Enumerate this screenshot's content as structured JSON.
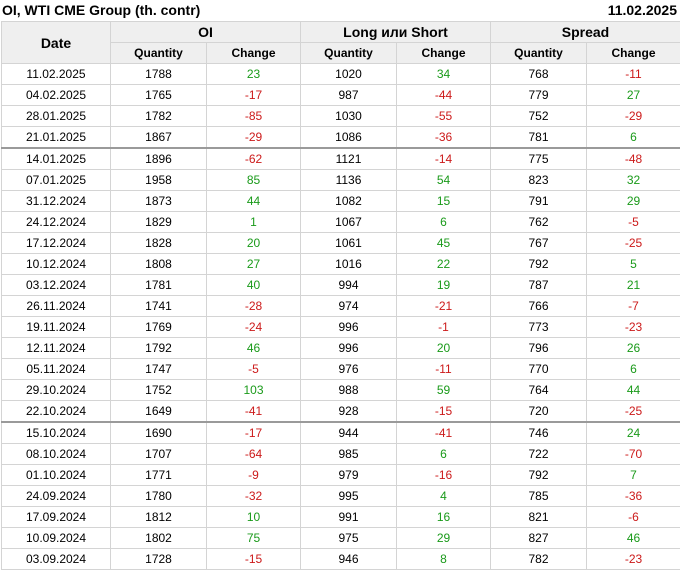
{
  "header": {
    "title": "OI, WTI CME Group (th. contr)",
    "date": "11.02.2025"
  },
  "table": {
    "date_label": "Date",
    "groups": [
      "OI",
      "Long или Short",
      "Spread"
    ],
    "sub_labels": [
      "Quantity",
      "Change",
      "Quantity",
      "Change",
      "Quantity",
      "Change"
    ],
    "colors": {
      "positive": "#1a9a1a",
      "negative": "#cc1a1a",
      "header_bg": "#efefef"
    },
    "rows": [
      [
        "11.02.2025",
        "1788",
        "23",
        "1020",
        "34",
        "768",
        "-11"
      ],
      [
        "04.02.2025",
        "1765",
        "-17",
        "987",
        "-44",
        "779",
        "27"
      ],
      [
        "28.01.2025",
        "1782",
        "-85",
        "1030",
        "-55",
        "752",
        "-29"
      ],
      [
        "21.01.2025",
        "1867",
        "-29",
        "1086",
        "-36",
        "781",
        "6"
      ],
      [
        "14.01.2025",
        "1896",
        "-62",
        "1121",
        "-14",
        "775",
        "-48"
      ],
      [
        "07.01.2025",
        "1958",
        "85",
        "1136",
        "54",
        "823",
        "32"
      ],
      [
        "31.12.2024",
        "1873",
        "44",
        "1082",
        "15",
        "791",
        "29"
      ],
      [
        "24.12.2024",
        "1829",
        "1",
        "1067",
        "6",
        "762",
        "-5"
      ],
      [
        "17.12.2024",
        "1828",
        "20",
        "1061",
        "45",
        "767",
        "-25"
      ],
      [
        "10.12.2024",
        "1808",
        "27",
        "1016",
        "22",
        "792",
        "5"
      ],
      [
        "03.12.2024",
        "1781",
        "40",
        "994",
        "19",
        "787",
        "21"
      ],
      [
        "26.11.2024",
        "1741",
        "-28",
        "974",
        "-21",
        "766",
        "-7"
      ],
      [
        "19.11.2024",
        "1769",
        "-24",
        "996",
        "-1",
        "773",
        "-23"
      ],
      [
        "12.11.2024",
        "1792",
        "46",
        "996",
        "20",
        "796",
        "26"
      ],
      [
        "05.11.2024",
        "1747",
        "-5",
        "976",
        "-11",
        "770",
        "6"
      ],
      [
        "29.10.2024",
        "1752",
        "103",
        "988",
        "59",
        "764",
        "44"
      ],
      [
        "22.10.2024",
        "1649",
        "-41",
        "928",
        "-15",
        "720",
        "-25"
      ],
      [
        "15.10.2024",
        "1690",
        "-17",
        "944",
        "-41",
        "746",
        "24"
      ],
      [
        "08.10.2024",
        "1707",
        "-64",
        "985",
        "6",
        "722",
        "-70"
      ],
      [
        "01.10.2024",
        "1771",
        "-9",
        "979",
        "-16",
        "792",
        "7"
      ],
      [
        "24.09.2024",
        "1780",
        "-32",
        "995",
        "4",
        "785",
        "-36"
      ],
      [
        "17.09.2024",
        "1812",
        "10",
        "991",
        "16",
        "821",
        "-6"
      ],
      [
        "10.09.2024",
        "1802",
        "75",
        "975",
        "29",
        "827",
        "46"
      ],
      [
        "03.09.2024",
        "1728",
        "-15",
        "946",
        "8",
        "782",
        "-23"
      ]
    ]
  }
}
